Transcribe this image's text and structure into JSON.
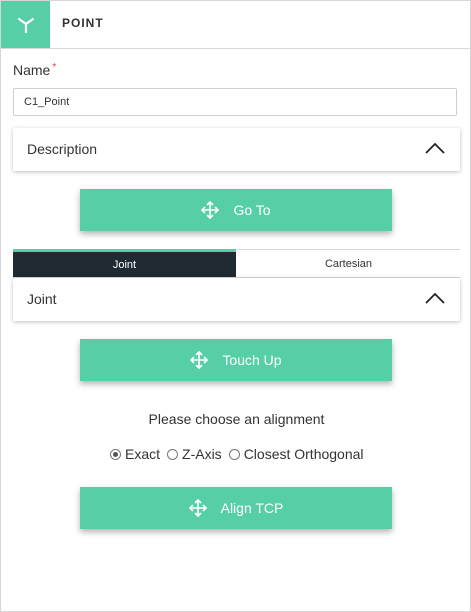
{
  "header": {
    "title": "POINT",
    "icon": "tool-point-icon"
  },
  "name_field": {
    "label": "Name",
    "required_mark": "*",
    "value": "C1_Point"
  },
  "description": {
    "title": "Description",
    "expanded": true
  },
  "go_to_button": {
    "label": "Go To",
    "icon": "move-arrows-icon"
  },
  "tabs": [
    {
      "label": "Joint",
      "active": true
    },
    {
      "label": "Cartesian",
      "active": false
    }
  ],
  "joint_panel": {
    "title": "Joint",
    "expanded": true
  },
  "touch_up_button": {
    "label": "Touch Up",
    "icon": "move-arrows-icon"
  },
  "alignment": {
    "prompt": "Please choose an alignment",
    "options": [
      {
        "label": "Exact",
        "selected": true
      },
      {
        "label": "Z-Axis",
        "selected": false
      },
      {
        "label": "Closest Orthogonal",
        "selected": false
      }
    ]
  },
  "align_tcp_button": {
    "label": "Align TCP",
    "icon": "move-arrows-icon"
  },
  "colors": {
    "accent": "#57cfa6",
    "tab_active_bg": "#1f2a33"
  }
}
